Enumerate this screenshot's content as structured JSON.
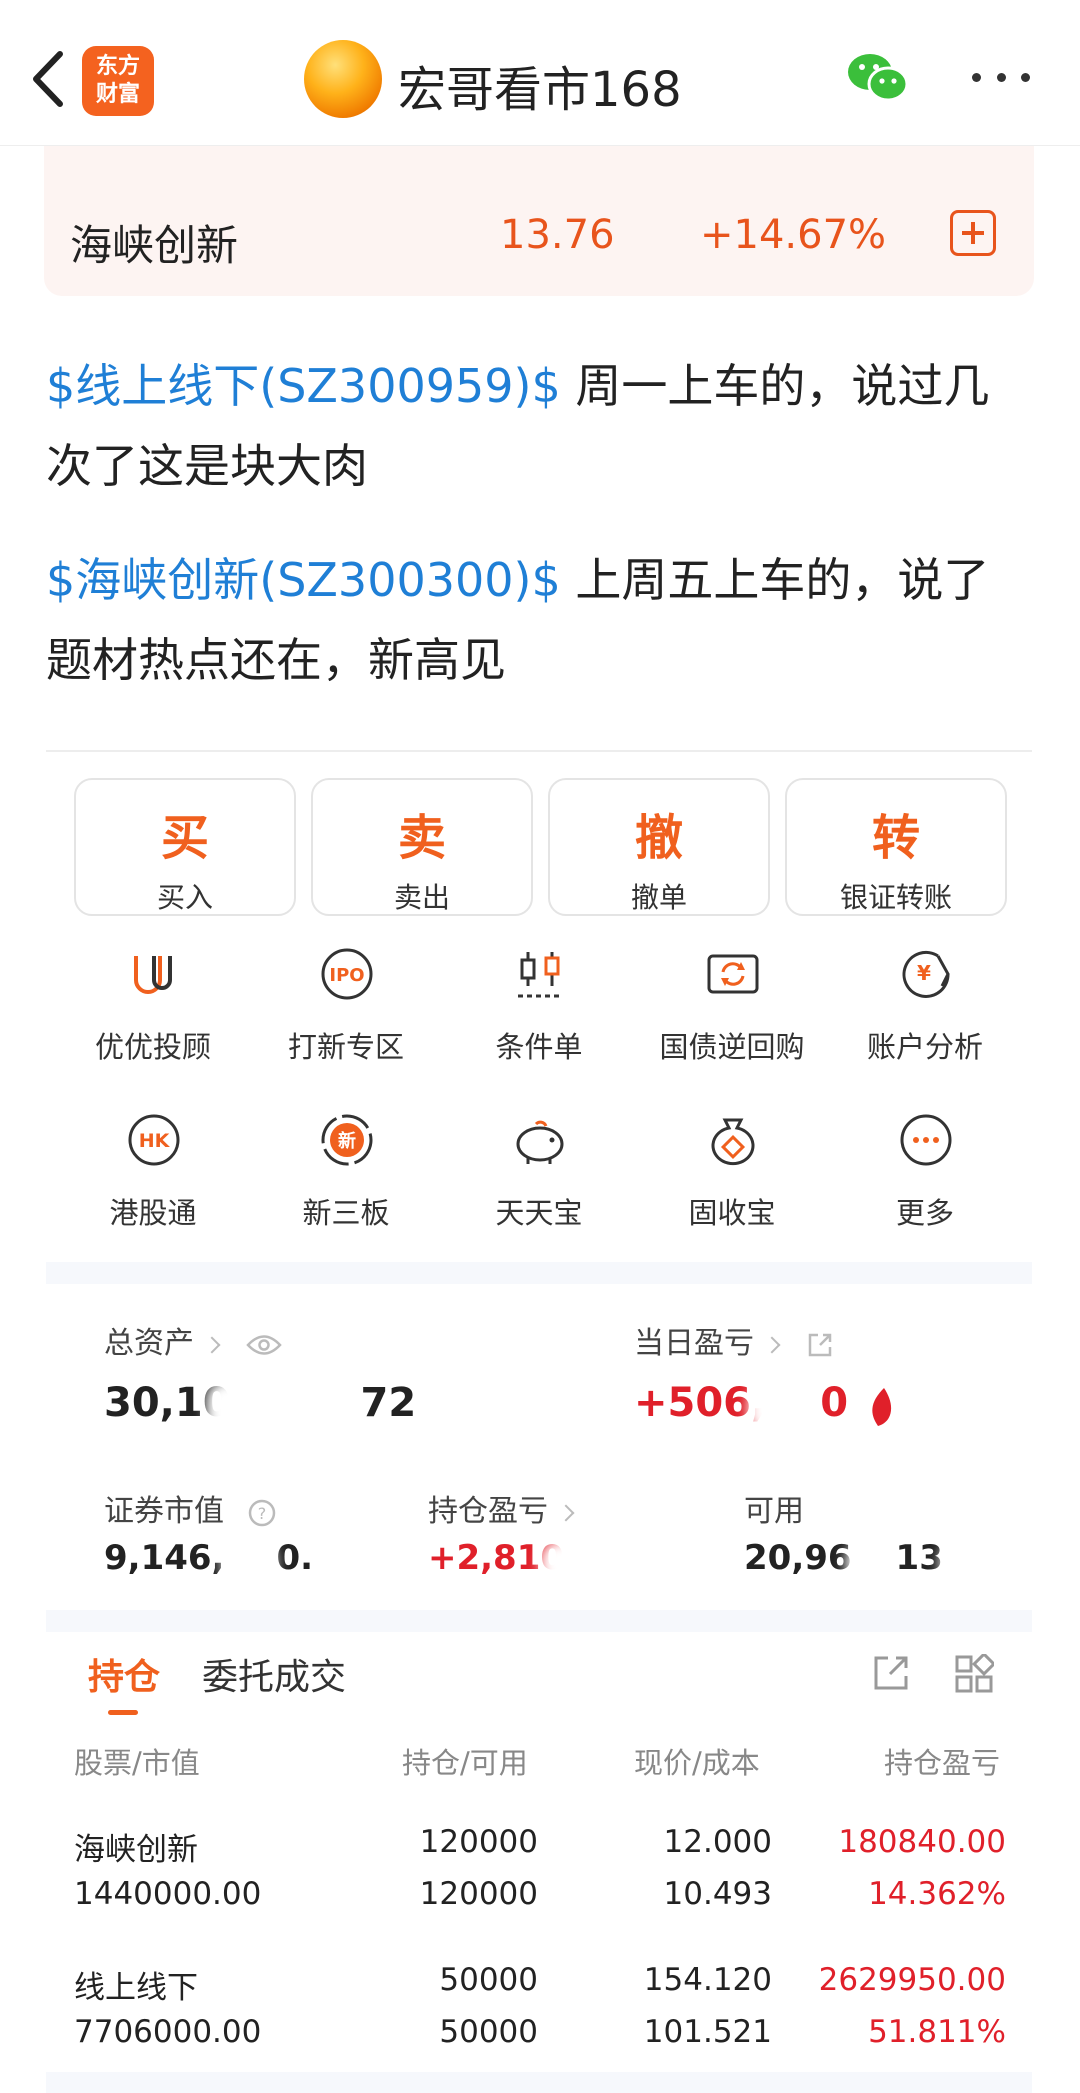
{
  "header": {
    "app_logo_text": "东方财富",
    "title": "宏哥看市168"
  },
  "stock_card": {
    "name": "海峡创新",
    "price": "13.76",
    "change": "+14.67%"
  },
  "post": {
    "p1_link": "$线上线下(SZ300959)$",
    "p1_line1": " 周一上车的，说过几",
    "p1_line2": "次了这是块大肉",
    "p2_link": "$海峡创新(SZ300300)$",
    "p2_line1": " 上周五上车的，说了",
    "p2_line2": "题材热点还在，新高见"
  },
  "trade_buttons": [
    {
      "big": "买",
      "small": "买入"
    },
    {
      "big": "卖",
      "small": "卖出"
    },
    {
      "big": "撤",
      "small": "撤单"
    },
    {
      "big": "转",
      "small": "银证转账"
    }
  ],
  "feature_grid": [
    {
      "label": "优优投顾",
      "icon": "youyou-icon"
    },
    {
      "label": "打新专区",
      "icon": "ipo-icon"
    },
    {
      "label": "条件单",
      "icon": "condition-order-icon"
    },
    {
      "label": "国债逆回购",
      "icon": "bond-repo-icon"
    },
    {
      "label": "账户分析",
      "icon": "account-analysis-icon"
    },
    {
      "label": "港股通",
      "icon": "hk-icon",
      "badge": "HK"
    },
    {
      "label": "新三板",
      "icon": "new-third-board-icon",
      "badge": "新"
    },
    {
      "label": "天天宝",
      "icon": "piggy-bank-icon"
    },
    {
      "label": "固收宝",
      "icon": "money-bag-icon"
    },
    {
      "label": "更多",
      "icon": "more-icon"
    }
  ],
  "assets": {
    "total_label": "总资产",
    "total_value_a": "30,10",
    "total_value_b": "72",
    "daily_pl_label": "当日盈亏",
    "daily_pl_value_a": "+506,",
    "daily_pl_value_b": "0",
    "market_value_label": "证券市值",
    "market_value": "9,146,",
    "market_value_b": "0.",
    "holding_pl_label": "持仓盈亏",
    "holding_pl_value": "+2,810",
    "available_label": "可用",
    "available_value_a": "20,96",
    "available_value_b": "13"
  },
  "holdings": {
    "tabs": [
      "持仓",
      "委托成交"
    ],
    "headers": [
      "股票/市值",
      "持仓/可用",
      "现价/成本",
      "持仓盈亏"
    ],
    "rows": [
      {
        "name": "海峡创新",
        "market_value": "1440000.00",
        "position": "120000",
        "available": "120000",
        "price": "12.000",
        "cost": "10.493",
        "pl": "180840.00",
        "pl_pct": "14.362%"
      },
      {
        "name": "线上线下",
        "market_value": "7706000.00",
        "position": "50000",
        "available": "50000",
        "price": "154.120",
        "cost": "101.521",
        "pl": "2629950.00",
        "pl_pct": "51.811%"
      }
    ]
  },
  "colors": {
    "accent": "#f0601e",
    "link": "#1f7fd6",
    "profit": "#e0202a"
  }
}
